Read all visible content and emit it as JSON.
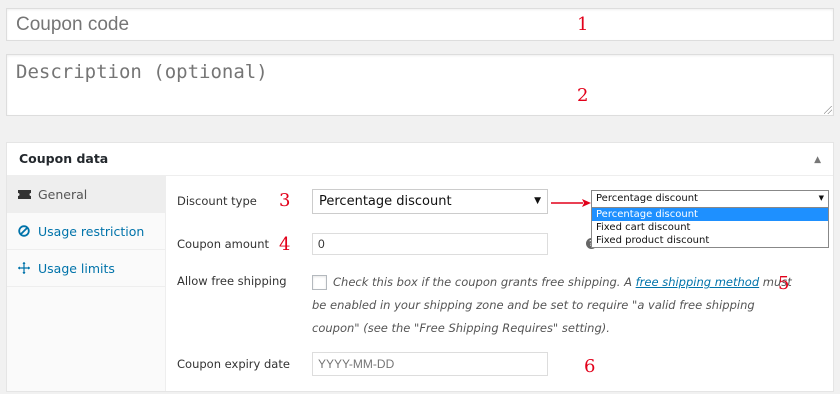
{
  "coupon_code": {
    "placeholder": "Coupon code"
  },
  "description": {
    "placeholder": "Description (optional)"
  },
  "annotations": [
    "1",
    "2",
    "3",
    "4",
    "5",
    "6"
  ],
  "panel": {
    "title": "Coupon data",
    "tabs": [
      {
        "label": "General",
        "icon": "ticket-icon",
        "active": true
      },
      {
        "label": "Usage restriction",
        "icon": "block-icon",
        "active": false
      },
      {
        "label": "Usage limits",
        "icon": "arrows-icon",
        "active": false
      }
    ]
  },
  "general": {
    "discount_type": {
      "label": "Discount type",
      "value": "Percentage discount"
    },
    "coupon_amount": {
      "label": "Coupon amount",
      "value": "0"
    },
    "free_shipping": {
      "label": "Allow free shipping",
      "text_before": "Check this box if the coupon grants free shipping. A ",
      "link": "free shipping method",
      "text_after": " must be enabled in your shipping zone and be set to require \"a valid free shipping coupon\" (see the \"Free Shipping Requires\" setting).",
      "checked": false
    },
    "expiry": {
      "label": "Coupon expiry date",
      "placeholder": "YYYY-MM-DD"
    }
  },
  "dropdown_popup": {
    "selected_value": "Percentage discount",
    "options": [
      "Percentage discount",
      "Fixed cart discount",
      "Fixed product discount"
    ],
    "highlighted_index": 0
  },
  "colors": {
    "annotation": "#e2001a",
    "link": "#0073aa",
    "highlight": "#1e90ff"
  }
}
